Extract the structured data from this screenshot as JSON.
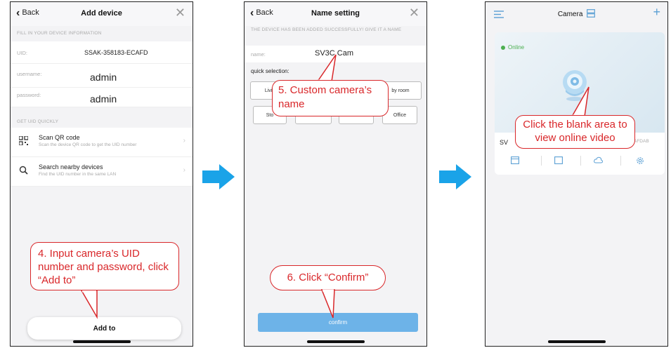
{
  "screen1": {
    "back": "Back",
    "title": "Add device",
    "close": "✕",
    "section_fill": "FILL IN YOUR DEVICE INFORMATION",
    "uid_label": "UID:",
    "uid_value": "SSAK-358183-ECAFD",
    "username_label": "username:",
    "username_value": "admin",
    "password_label": "password:",
    "password_value": "admin",
    "section_get": "GET UID QUICKLY",
    "scan_title": "Scan QR code",
    "scan_sub": "Scan the device QR code to get the UID number",
    "search_title": "Search nearby devices",
    "search_sub": "Find the UID number in the same LAN",
    "callout": "4. Input camera’s UID number and password, click “Add to”",
    "add_button": "Add to"
  },
  "screen2": {
    "back": "Back",
    "title": "Name setting",
    "close": "✕",
    "notice": "THE DEVICE HAS BEEN ADDED SUCCESSFULLY! GIVE IT A NAME",
    "name_label": "name:",
    "name_value": "SV3C Cam",
    "quick_selection": "quick selection:",
    "chips": [
      "Living",
      "by room",
      "Sto",
      "Office"
    ],
    "callout_name": "5. Custom camera’s name",
    "callout_confirm": "6. Click “Confirm”",
    "confirm_button": "confirm"
  },
  "screen3": {
    "title": "Camera",
    "status": "Online",
    "device_name": "SV",
    "uid_fragment": "AFDAB",
    "callout": "Click the blank area to view online video"
  },
  "colors": {
    "callout_red": "#d9272a",
    "arrow_blue": "#1aa3e8",
    "confirm_blue": "#6db3e8",
    "online_green": "#4caf50"
  }
}
